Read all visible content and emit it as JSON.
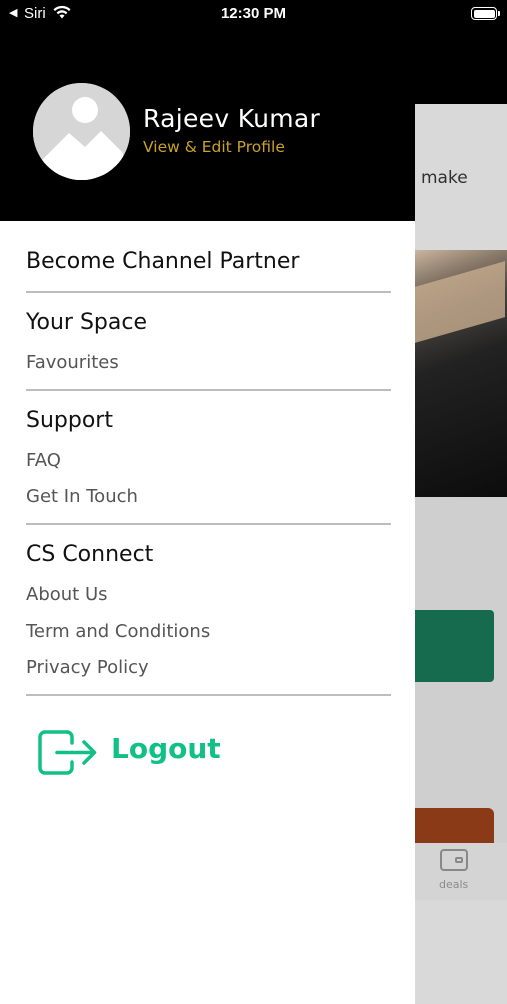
{
  "status_bar": {
    "back_label": "◀",
    "siri_label": "Siri",
    "time": "12:30 PM"
  },
  "background": {
    "peek_text": "make",
    "tab_deals_label": "deals"
  },
  "drawer": {
    "profile": {
      "name": "Rajeev Kumar",
      "edit_link": "View & Edit Profile"
    },
    "sections": {
      "become_partner": "Become Channel Partner",
      "your_space": {
        "title": "Your Space",
        "items": [
          "Favourites"
        ]
      },
      "support": {
        "title": "Support",
        "items": [
          "FAQ",
          "Get In Touch"
        ]
      },
      "cs_connect": {
        "title": "CS Connect",
        "items": [
          "About Us",
          "Term and Conditions",
          "Privacy Policy"
        ]
      }
    },
    "logout_label": "Logout"
  },
  "colors": {
    "accent_green": "#10c085",
    "link_gold": "#c9a227",
    "header_bg": "#000000"
  }
}
